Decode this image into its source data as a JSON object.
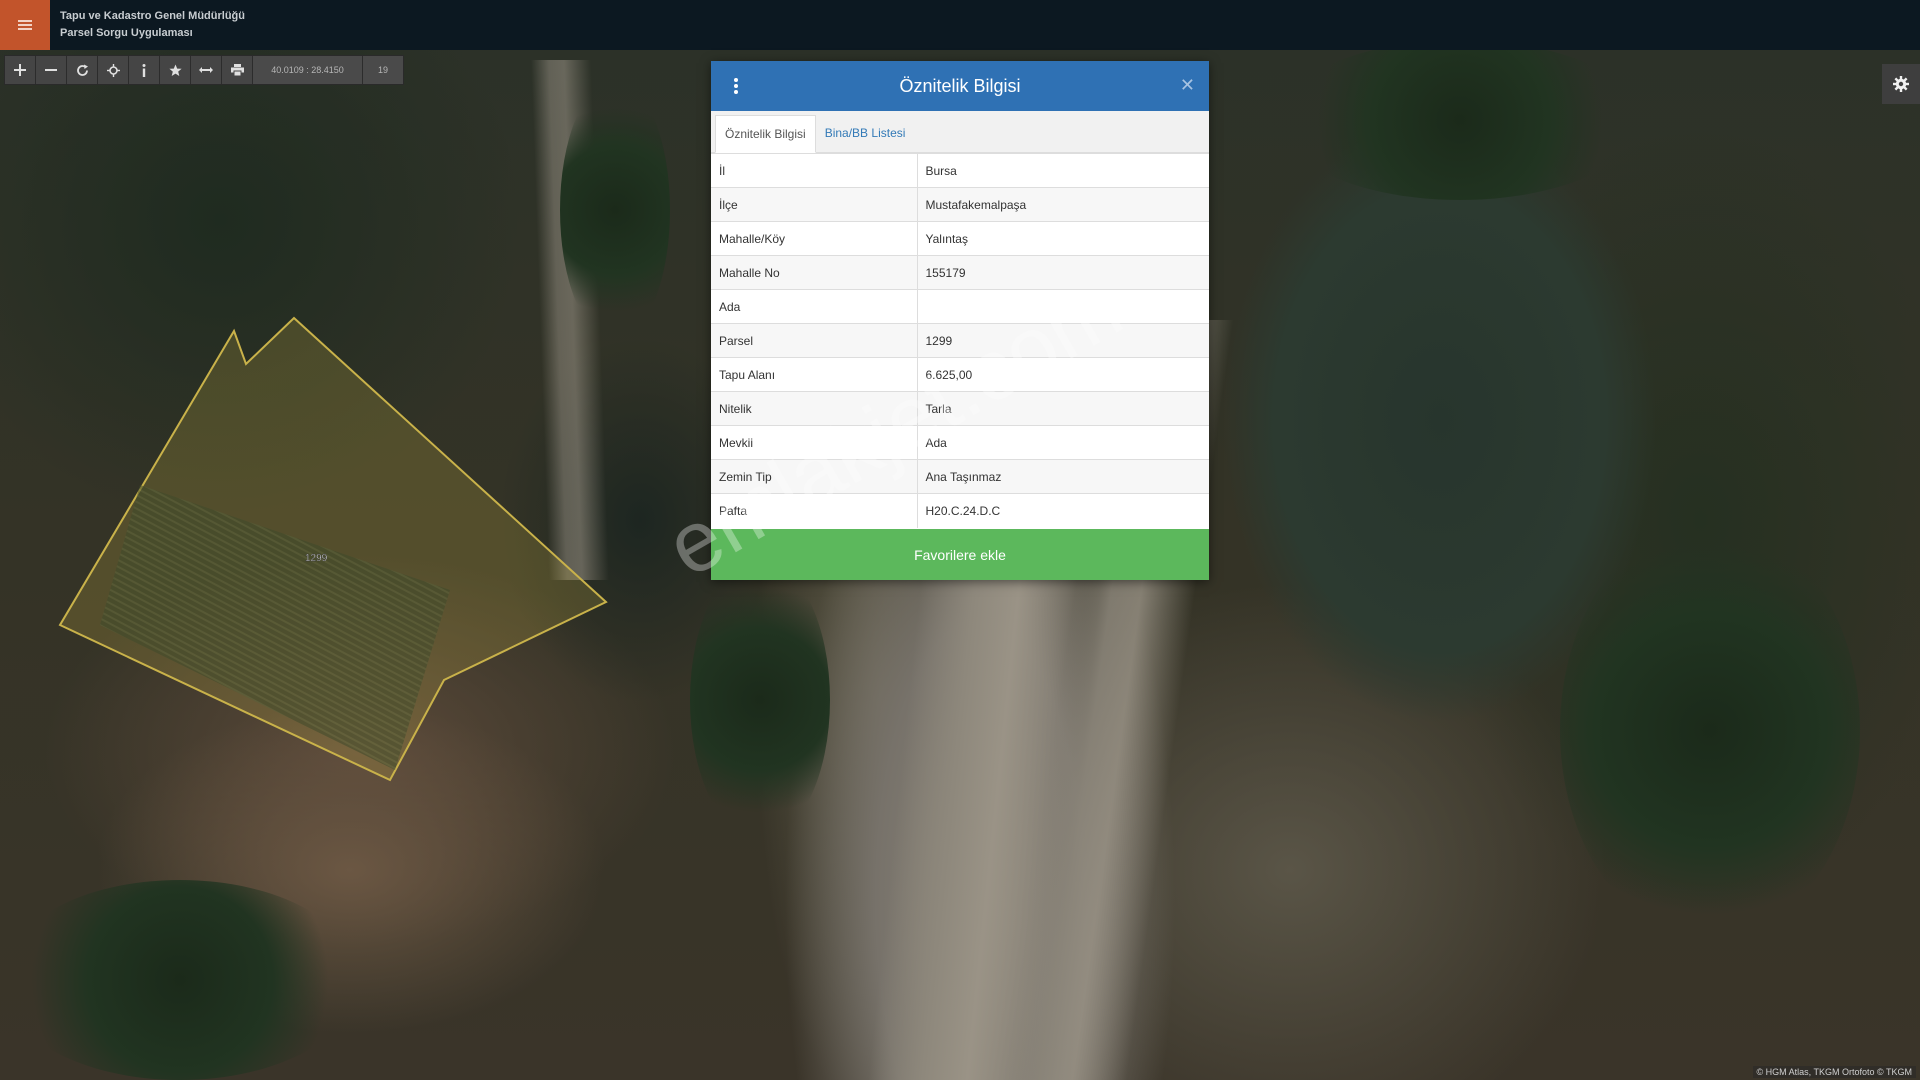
{
  "header": {
    "menu_icon": "hamburger-menu-icon",
    "title_line1": "Tapu ve Kadastro Genel Müdürlüğü",
    "title_line2": "Parsel Sorgu Uygulaması"
  },
  "toolbar": {
    "buttons": [
      "zoom-in-icon",
      "zoom-out-icon",
      "refresh-icon",
      "locate-icon",
      "info-icon",
      "star-icon",
      "measure-icon",
      "print-icon"
    ],
    "coordinates": "40.0109 : 28.4150",
    "zoom_level": "19"
  },
  "map": {
    "parcel_label": "1299",
    "parcel_outline_color": "#c9b24a",
    "attribution": "© HGM Atlas, TKGM Ortofoto © TKGM"
  },
  "modal": {
    "title": "Öznitelik Bilgisi",
    "tabs": [
      {
        "label": "Öznitelik Bilgisi",
        "active": true
      },
      {
        "label": "Bina/BB Listesi",
        "active": false
      }
    ],
    "rows": [
      {
        "key": "İl",
        "value": "Bursa"
      },
      {
        "key": "İlçe",
        "value": "Mustafakemalpaşa"
      },
      {
        "key": "Mahalle/Köy",
        "value": "Yalıntaş"
      },
      {
        "key": "Mahalle No",
        "value": "155179"
      },
      {
        "key": "Ada",
        "value": ""
      },
      {
        "key": "Parsel",
        "value": "1299"
      },
      {
        "key": "Tapu Alanı",
        "value": "6.625,00"
      },
      {
        "key": "Nitelik",
        "value": "Tarla"
      },
      {
        "key": "Mevkii",
        "value": "Ada"
      },
      {
        "key": "Zemin Tip",
        "value": "Ana Taşınmaz"
      },
      {
        "key": "Pafta",
        "value": "H20.C.24.D.C"
      }
    ],
    "favorite_button": "Favorilere ekle",
    "header_color": "#2f71b4",
    "button_color": "#5cb85c"
  },
  "watermark": "emlakjet.com"
}
